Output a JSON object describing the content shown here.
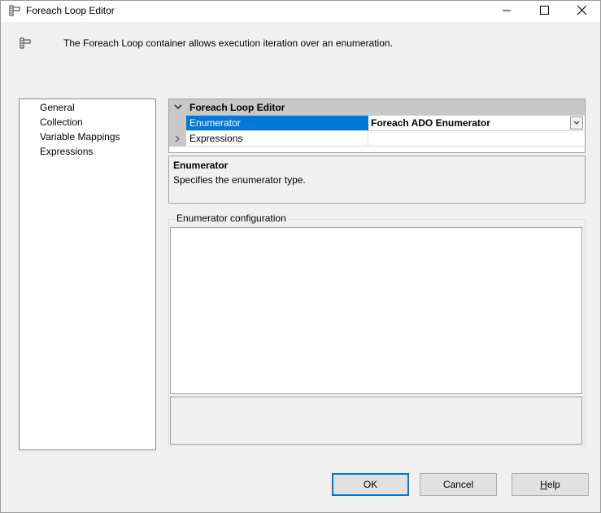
{
  "window": {
    "title": "Foreach Loop Editor",
    "icon": "foreach-loop-icon",
    "controls": [
      "minimize-icon",
      "maximize-icon",
      "close-icon"
    ]
  },
  "header": {
    "icon": "foreach-loop-icon",
    "description": "The Foreach Loop container allows execution iteration over an enumeration."
  },
  "nav": {
    "items": [
      {
        "label": "General"
      },
      {
        "label": "Collection",
        "selected": true
      },
      {
        "label": "Variable Mappings"
      },
      {
        "label": "Expressions"
      }
    ]
  },
  "property_grid": {
    "category": "Foreach Loop Editor",
    "rows": [
      {
        "name": "Enumerator",
        "value": "Foreach ADO Enumerator",
        "selected": true
      },
      {
        "name": "Expressions",
        "value": ""
      }
    ]
  },
  "description_panel": {
    "title": "Enumerator",
    "text": "Specifies the enumerator type."
  },
  "config": {
    "group_label": "Enumerator configuration"
  },
  "buttons": {
    "ok": "OK",
    "cancel": "Cancel",
    "help_first": "H",
    "help_rest": "elp"
  },
  "colors": {
    "selection": "#0078d7",
    "category_bg": "#c8c8c8",
    "window_bg": "#f0f0f0"
  }
}
